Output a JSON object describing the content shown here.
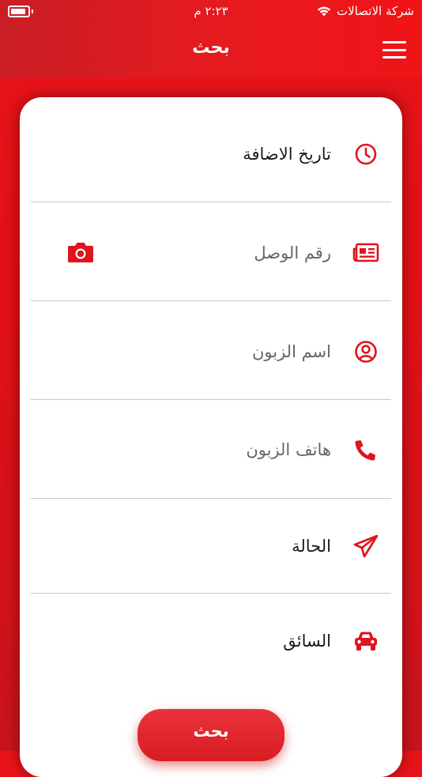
{
  "status_bar": {
    "carrier": "شركة الاتصالات",
    "time": "٢:٢٣ م"
  },
  "header": {
    "title": "بحث"
  },
  "fields": [
    {
      "label": "تاريخ الاضافة",
      "icon": "clock-icon",
      "filled": true
    },
    {
      "label": "رقم الوصل",
      "icon": "receipt-icon",
      "filled": false
    },
    {
      "label": "اسم الزبون",
      "icon": "user-circle-icon",
      "filled": false
    },
    {
      "label": "هاتف الزبون",
      "icon": "phone-icon",
      "filled": false
    },
    {
      "label": "الحالة",
      "icon": "paper-plane-icon",
      "filled": true
    },
    {
      "label": "السائق",
      "icon": "car-icon",
      "filled": true
    }
  ],
  "actions": {
    "search_label": "بحث"
  },
  "colors": {
    "accent": "#e5141b",
    "icon": "#e0141c"
  }
}
